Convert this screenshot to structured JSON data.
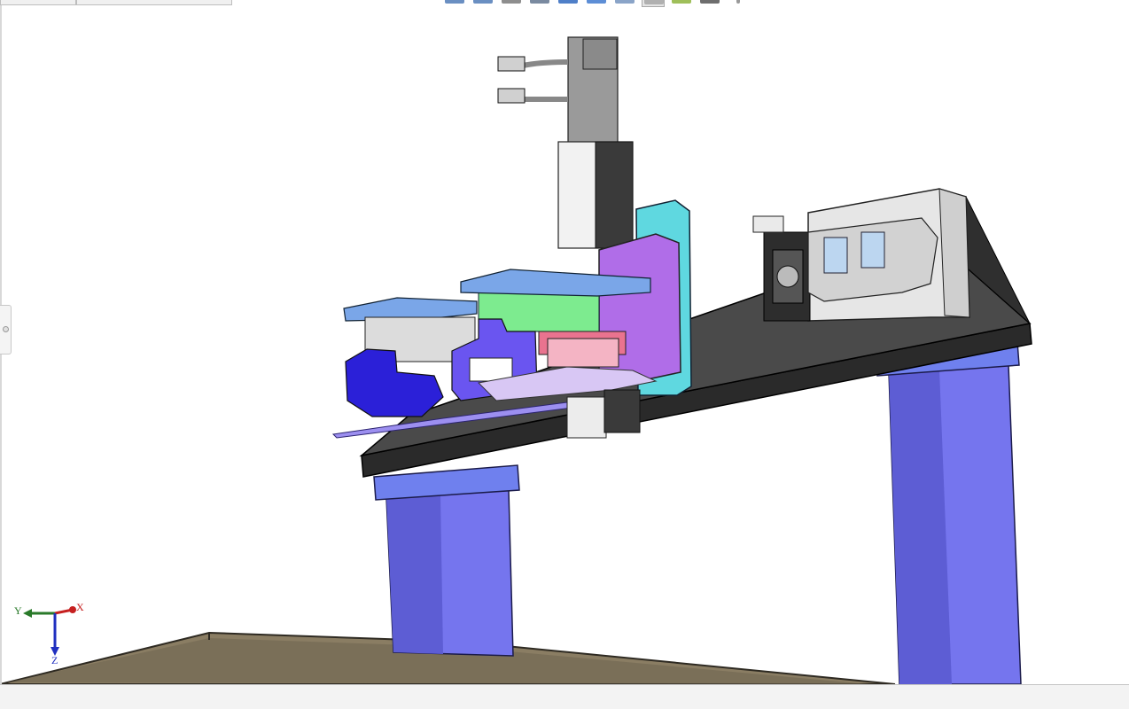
{
  "window": {
    "title": ""
  },
  "doc_tabs": [
    {
      "label": ""
    },
    {
      "label": ""
    }
  ],
  "heads_up_toolbar": {
    "items": [
      {
        "icon": "zoom-to-fit-icon"
      },
      {
        "icon": "zoom-to-area-icon"
      },
      {
        "icon": "previous-view-icon"
      },
      {
        "icon": "section-view-icon"
      },
      {
        "icon": "dynamic-annotation-views-icon"
      },
      {
        "icon": "view-orientation-icon"
      },
      {
        "icon": "display-style-icon"
      },
      {
        "icon": "hide-show-items-icon",
        "active": true
      },
      {
        "icon": "edit-appearance-icon"
      },
      {
        "icon": "apply-scene-icon"
      },
      {
        "icon": "view-settings-icon"
      }
    ]
  },
  "triad": {
    "x_label": "X",
    "y_label": "Y",
    "z_label": "Z"
  },
  "colors": {
    "gantry_beam": "#3a3a3a",
    "columns": "#7575ee",
    "column_caps": "#6f80ee",
    "end_plate": "#e6e6e6",
    "motor": "#9a9a9a",
    "carriage_purple": "#b06de8",
    "carriage_cyan": "#5fd8e0",
    "block_green": "#7deb8f",
    "gripper_blue": "#2b20d8",
    "gripper_violet": "#6a55f0",
    "plate_lightblue": "#7aa6e8",
    "pink_block": "#e9738f",
    "floor": "#8a7d63"
  },
  "status_bar": {
    "text": ""
  }
}
